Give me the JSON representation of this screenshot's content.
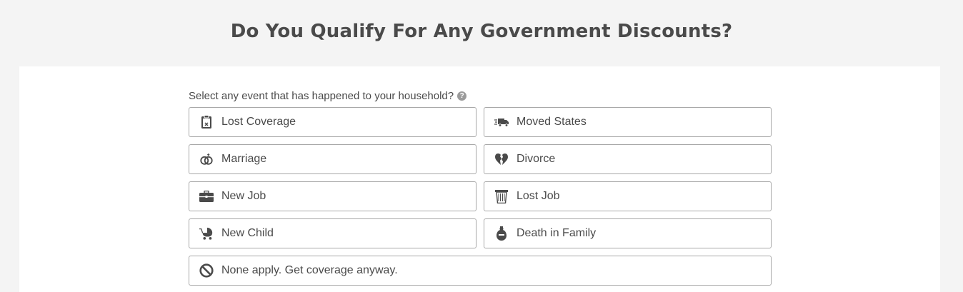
{
  "page": {
    "title": "Do You Qualify For Any Government Discounts?"
  },
  "question": {
    "text": "Select any event that has happened to your household?",
    "help_glyph": "?"
  },
  "options": [
    {
      "label": "Lost Coverage",
      "icon": "clipboard-x-icon"
    },
    {
      "label": "Moved States",
      "icon": "moving-truck-icon"
    },
    {
      "label": "Marriage",
      "icon": "rings-icon"
    },
    {
      "label": "Divorce",
      "icon": "broken-heart-icon"
    },
    {
      "label": "New Job",
      "icon": "briefcase-icon"
    },
    {
      "label": "Lost Job",
      "icon": "trash-bin-icon"
    },
    {
      "label": "New Child",
      "icon": "baby-stroller-icon"
    },
    {
      "label": "Death in Family",
      "icon": "urn-icon"
    },
    {
      "label": "None apply. Get coverage anyway.",
      "icon": "prohibited-icon"
    }
  ],
  "colors": {
    "text": "#4a4a4a",
    "border": "#a8a8a8",
    "background": "#f4f4f4",
    "card": "#ffffff"
  }
}
